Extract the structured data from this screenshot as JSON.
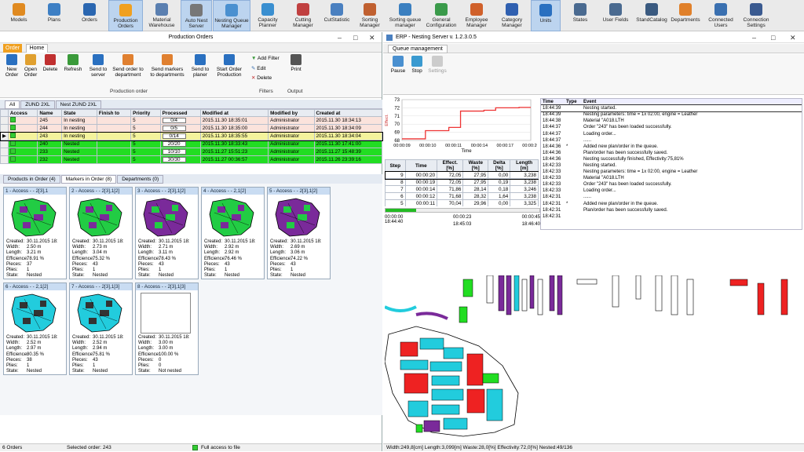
{
  "toolbar": {
    "items": [
      {
        "label": "Models",
        "color": "#e08a20"
      },
      {
        "label": "Plans",
        "color": "#3d7fc4"
      },
      {
        "label": "Orders",
        "color": "#2a66b0"
      },
      {
        "label": "Production\nOrders",
        "color": "#f0a020"
      },
      {
        "label": "Material\nWarehouse",
        "color": "#5a7fb0"
      },
      {
        "label": "Auto Nest\nServer",
        "color": "#777"
      },
      {
        "label": "Nesting Queue\nManager",
        "color": "#4a90d0"
      },
      {
        "label": "Capacity\nPlanner",
        "color": "#3a8fd0"
      },
      {
        "label": "Cutting\nManager",
        "color": "#c04040"
      },
      {
        "label": "CutStatistic",
        "color": "#4a80c0"
      },
      {
        "label": "Sorting\nManager",
        "color": "#c06030"
      },
      {
        "label": "Sorting queue\nmanager",
        "color": "#3a7fc0"
      },
      {
        "label": "General\nConfiguration",
        "color": "#3a9a4a"
      },
      {
        "label": "Employee\nManager",
        "color": "#d0602a"
      },
      {
        "label": "Category\nManager",
        "color": "#3060b0"
      },
      {
        "label": "Units",
        "color": "#2a70c0"
      },
      {
        "label": "States",
        "color": "#4a6a90"
      },
      {
        "label": "User Fields",
        "color": "#4a6a90"
      },
      {
        "label": "StandCatalog",
        "color": "#3a5a80"
      },
      {
        "label": "Departments",
        "color": "#e0802a"
      },
      {
        "label": "Connected\nUsers",
        "color": "#3a70b0"
      },
      {
        "label": "Connection\nSettings",
        "color": "#3a5a90"
      }
    ]
  },
  "left_window": {
    "title": "Production Orders",
    "tab_order": "Order",
    "tab_home": "Home",
    "ribbon_buttons": [
      {
        "label": "New\nOrder",
        "color": "#2a70c0"
      },
      {
        "label": "Open\nOrder",
        "color": "#e0a030"
      },
      {
        "label": "Delete",
        "color": "#c03030"
      },
      {
        "label": "Refresh",
        "color": "#3a9a3a"
      },
      {
        "label": "Send to\nserver",
        "color": "#2a70c0"
      },
      {
        "label": "Send order to\ndepartment",
        "color": "#e08030"
      },
      {
        "label": "Send markers\nto departments",
        "color": "#e08030"
      },
      {
        "label": "Send to\nplaner",
        "color": "#2a70c0"
      },
      {
        "label": "Start Order\nProduction",
        "color": "#2a70c0"
      }
    ],
    "group_production": "Production order",
    "filter_add": "Add Filter",
    "filter_edit": "Edit",
    "filter_delete": "Delete",
    "group_filters": "Filters",
    "print": "Print",
    "group_output": "Output",
    "view_tabs": [
      "All",
      "ZUND 2XL",
      "Nest ZUND 2XL"
    ],
    "columns": [
      "Access",
      "Name",
      "State",
      "Finish to",
      "Priority",
      "Processed",
      "Modified at",
      "Modified by",
      "Created at"
    ],
    "rows": [
      {
        "name": "245",
        "state": "In nesting",
        "priority": "5",
        "processed": "0/4",
        "modified": "2015.11.30 18:35:01",
        "by": "Administrator",
        "created": "2015.11.30 18:34:13",
        "bg": "#fbe3dc"
      },
      {
        "name": "244",
        "state": "In nesting",
        "priority": "5",
        "processed": "0/5",
        "modified": "2015.11.30 18:35:00",
        "by": "Administrator",
        "created": "2015.11.30 18:34:09",
        "bg": "#fbe3dc"
      },
      {
        "name": "243",
        "state": "In nesting",
        "priority": "5",
        "processed": "0/14",
        "modified": "2015.11.30 18:35:55",
        "by": "Administrator",
        "created": "2015.11.30 18:34:04",
        "bg": "#f4f39c"
      },
      {
        "name": "240",
        "state": "Nested",
        "priority": "5",
        "processed": "20/20",
        "modified": "2015.11.30 18:33:43",
        "by": "Administrator",
        "created": "2015.11.30 17:41:00",
        "bg": "#22dd22"
      },
      {
        "name": "233",
        "state": "Nested",
        "priority": "5",
        "processed": "10/10",
        "modified": "2015.11.27 15:51:23",
        "by": "Administrator",
        "created": "2015.11.27 15:48:39",
        "bg": "#22dd22"
      },
      {
        "name": "232",
        "state": "Nested",
        "priority": "5",
        "processed": "30/30",
        "modified": "2015.11.27 00:36:57",
        "by": "Administrator",
        "created": "2015.11.26 23:39:16",
        "bg": "#22dd22"
      }
    ],
    "sub_tabs": [
      "Products in Order (4)",
      "Markers in Order (8)",
      "Departments (0)"
    ],
    "info_labels": [
      "Created:",
      "Width:",
      "Length:",
      "Efficience:",
      "Pieces:",
      "Plies:",
      "State:"
    ],
    "markers": [
      {
        "title": "1 - Access - - 2[3],1",
        "created": "30.11.2015 18:",
        "width": "2.50 m",
        "length": "3.21 m",
        "eff": "78.91 %",
        "pieces": "37",
        "plies": "1",
        "state": "Nested",
        "colors": [
          "#22cc44",
          "#7a2a9a"
        ]
      },
      {
        "title": "2 - Access - - 2[3],1[2]",
        "created": "30.11.2015 18:",
        "width": "2.73 m",
        "length": "3.04 m",
        "eff": "75.32 %",
        "pieces": "43",
        "plies": "1",
        "state": "Nested",
        "colors": [
          "#22cc44",
          "#7a2a9a"
        ]
      },
      {
        "title": "3 - Access - - 2[3],1[2]",
        "created": "30.11.2015 18:",
        "width": "2.71 m",
        "length": "3.11 m",
        "eff": "78.43 %",
        "pieces": "43",
        "plies": "1",
        "state": "Nested",
        "colors": [
          "#7a2a9a",
          "#22cc44"
        ]
      },
      {
        "title": "4 - Access - - 2,1[2]",
        "created": "30.11.2015 18:",
        "width": "2.92 m",
        "length": "2.92 m",
        "eff": "76.46 %",
        "pieces": "43",
        "plies": "1",
        "state": "Nested",
        "colors": [
          "#22cc44",
          "#7a2a9a"
        ]
      },
      {
        "title": "5 - Access - - 2[3],1[2]",
        "created": "30.11.2015 18:",
        "width": "2.69 m",
        "length": "3.06 m",
        "eff": "74.22 %",
        "pieces": "43",
        "plies": "1",
        "state": "Nested",
        "colors": [
          "#7a2a9a",
          "#22cc44"
        ]
      },
      {
        "title": "6 - Access - - 2,1[2]",
        "created": "30.11.2015 18:",
        "width": "2.52 m",
        "length": "2.97 m",
        "eff": "80.35 %",
        "pieces": "38",
        "plies": "1",
        "state": "Nested",
        "colors": [
          "#22ccdd",
          "#333"
        ]
      },
      {
        "title": "7 - Access - - 2[3],1[3]",
        "created": "30.11.2015 18:",
        "width": "2.52 m",
        "length": "2.94 m",
        "eff": "75.81 %",
        "pieces": "43",
        "plies": "1",
        "state": "Nested",
        "colors": [
          "#22ccdd",
          "#333"
        ]
      },
      {
        "title": "8 - Access - - 2[3],1[3]",
        "created": "30.11.2015 18:",
        "width": "3.00 m",
        "length": "3.00 m",
        "eff": "100.00 %",
        "pieces": "0",
        "plies": "0",
        "state": "Not nested",
        "colors": [
          "#fff",
          "#fff"
        ]
      }
    ],
    "status_count": "6 Orders",
    "status_selected": "Selected order: 243",
    "status_access": "Full access to file"
  },
  "right_window": {
    "title": "ERP - Nesting Server v. 1.2.3.0.5",
    "tab": "Queue management",
    "btn_pause": "Pause",
    "btn_stop": "Stop",
    "btn_settings": "Settings",
    "chart_data": {
      "type": "line",
      "x_ticks": [
        "00:00:09",
        "00:00:10",
        "00:00:11",
        "00:00:14",
        "00:00:17",
        "00:00:20"
      ],
      "xlabel": "Time",
      "ylabel": "Effect.",
      "ylim": [
        68,
        73
      ],
      "y_ticks": [
        "73",
        "72",
        "71",
        "70",
        "69",
        "68"
      ],
      "values": [
        68.2,
        68.2,
        69.2,
        69.2,
        69.6,
        71.6,
        71.6,
        71.7,
        72.0,
        72.0,
        72.05,
        72.05
      ]
    },
    "step_columns": [
      "Step",
      "Time",
      "Effect.\n[%]",
      "Waste\n[%]",
      "Delta\n[%]",
      "Length\n[m]"
    ],
    "step_rows": [
      {
        "step": "9",
        "time": "00:00:20",
        "eff": "72,05",
        "waste": "27,95",
        "delta": "0,00",
        "len": "3,238"
      },
      {
        "step": "8",
        "time": "00:00:19",
        "eff": "72,05",
        "waste": "27,95",
        "delta": "0,19",
        "len": "3,238"
      },
      {
        "step": "7",
        "time": "00:00:14",
        "eff": "71,86",
        "waste": "28,14",
        "delta": "0,18",
        "len": "3,246"
      },
      {
        "step": "6",
        "time": "00:00:12",
        "eff": "71,68",
        "waste": "28,32",
        "delta": "1,64",
        "len": "3,238"
      },
      {
        "step": "5",
        "time": "00:00:11",
        "eff": "70,04",
        "waste": "29,96",
        "delta": "0,00",
        "len": "3,325"
      }
    ],
    "timeline": {
      "left": "00:00:00",
      "mid": "00:00:23",
      "right": "00:00:45",
      "t1": "18:44:40",
      "t2": "18:45:03",
      "t3": "18:46:40"
    },
    "log_columns": [
      "Time",
      "Type",
      "Event"
    ],
    "log_rows": [
      {
        "time": "18:44:39",
        "type": "",
        "event": "Nesting started."
      },
      {
        "time": "18:44:39",
        "type": "",
        "event": "Nesting parameters: time = 1x 02:00, engine = Leather"
      },
      {
        "time": "18:44:38",
        "type": "",
        "event": "Material \"A018.LTH"
      },
      {
        "time": "18:44:37",
        "type": "",
        "event": "Order \"243\" has been loaded successfully."
      },
      {
        "time": "18:44:37",
        "type": "",
        "event": "Loading order..."
      },
      {
        "time": "18:44:37",
        "type": "",
        "event": "......"
      },
      {
        "time": "18:44:36",
        "type": "*",
        "event": "Added new plan/order in the queue."
      },
      {
        "time": "18:44:36",
        "type": "",
        "event": "Plan/order has been successfully saved."
      },
      {
        "time": "18:44:36",
        "type": "",
        "event": "Nesting successfully finished, Effectivity:75,81%"
      },
      {
        "time": "18:42:33",
        "type": "",
        "event": "Nesting started."
      },
      {
        "time": "18:42:33",
        "type": "",
        "event": "Nesting parameters: time = 1x 02:00, engine = Leather"
      },
      {
        "time": "18:42:33",
        "type": "",
        "event": "Material \"A018.LTH"
      },
      {
        "time": "18:42:33",
        "type": "",
        "event": "Order \"243\" has been loaded successfully."
      },
      {
        "time": "18:42:33",
        "type": "",
        "event": "Loading order..."
      },
      {
        "time": "18:42:31",
        "type": "",
        "event": "......"
      },
      {
        "time": "18:42:31",
        "type": "*",
        "event": "Added new plan/order in the queue."
      },
      {
        "time": "18:42:31",
        "type": "",
        "event": "Plan/order has been successfully saved."
      },
      {
        "time": "18:42:31",
        "type": "",
        "event": ""
      }
    ],
    "status": "Width:249,8[cm]  Length:3,099[m]  Waste:28,0[%]  Effectivity:72,0[%]  Nested:49/136"
  }
}
